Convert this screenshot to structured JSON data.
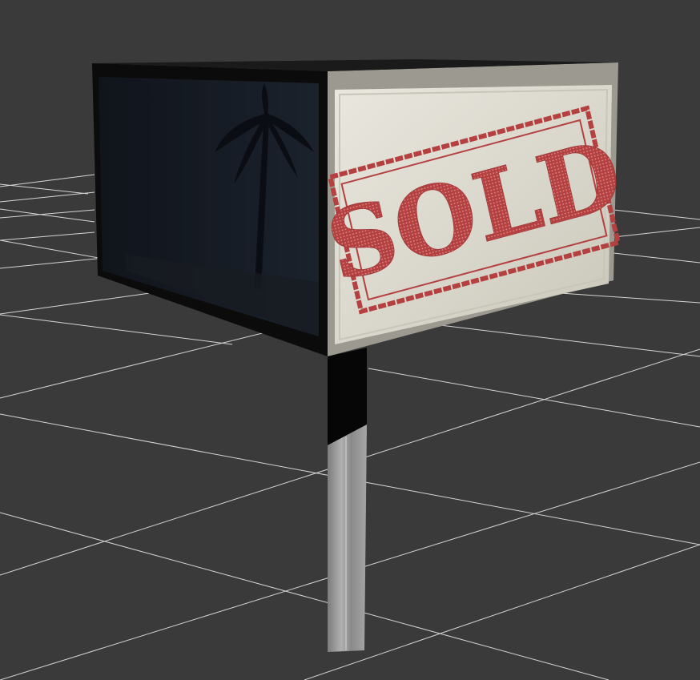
{
  "viewport": {
    "background_color": "#3a3a3a",
    "grid_color": "#e6e6e6",
    "grid_visible": true
  },
  "model": {
    "sign_front_stamp_text": "SOLD",
    "stamp_color": "#b54040",
    "board_color": "#dddbd1",
    "left_panel_color": "#121821",
    "post_color": "#8d8d8d",
    "frame_color": "#0c0c0c"
  }
}
